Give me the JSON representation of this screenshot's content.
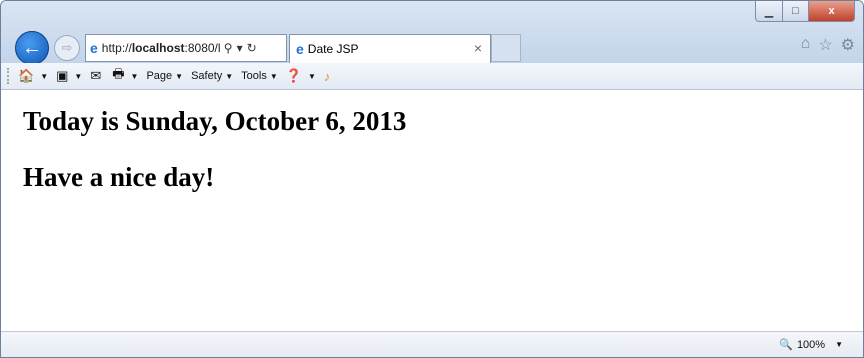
{
  "window": {
    "controls": {
      "minimize": "▁",
      "maximize": "□",
      "close": "x"
    }
  },
  "address": {
    "url_prefix": "http://",
    "url_host": "localhost",
    "url_rest": ":8080/l"
  },
  "tabs": [
    {
      "title": "Date JSP",
      "close": "×"
    }
  ],
  "command_bar": {
    "items": [
      {
        "label": "Page"
      },
      {
        "label": "Safety"
      },
      {
        "label": "Tools"
      }
    ]
  },
  "content": {
    "heading1": "Today is Sunday, October 6, 2013",
    "heading2": "Have a nice day!"
  },
  "status": {
    "zoom": "100%"
  }
}
